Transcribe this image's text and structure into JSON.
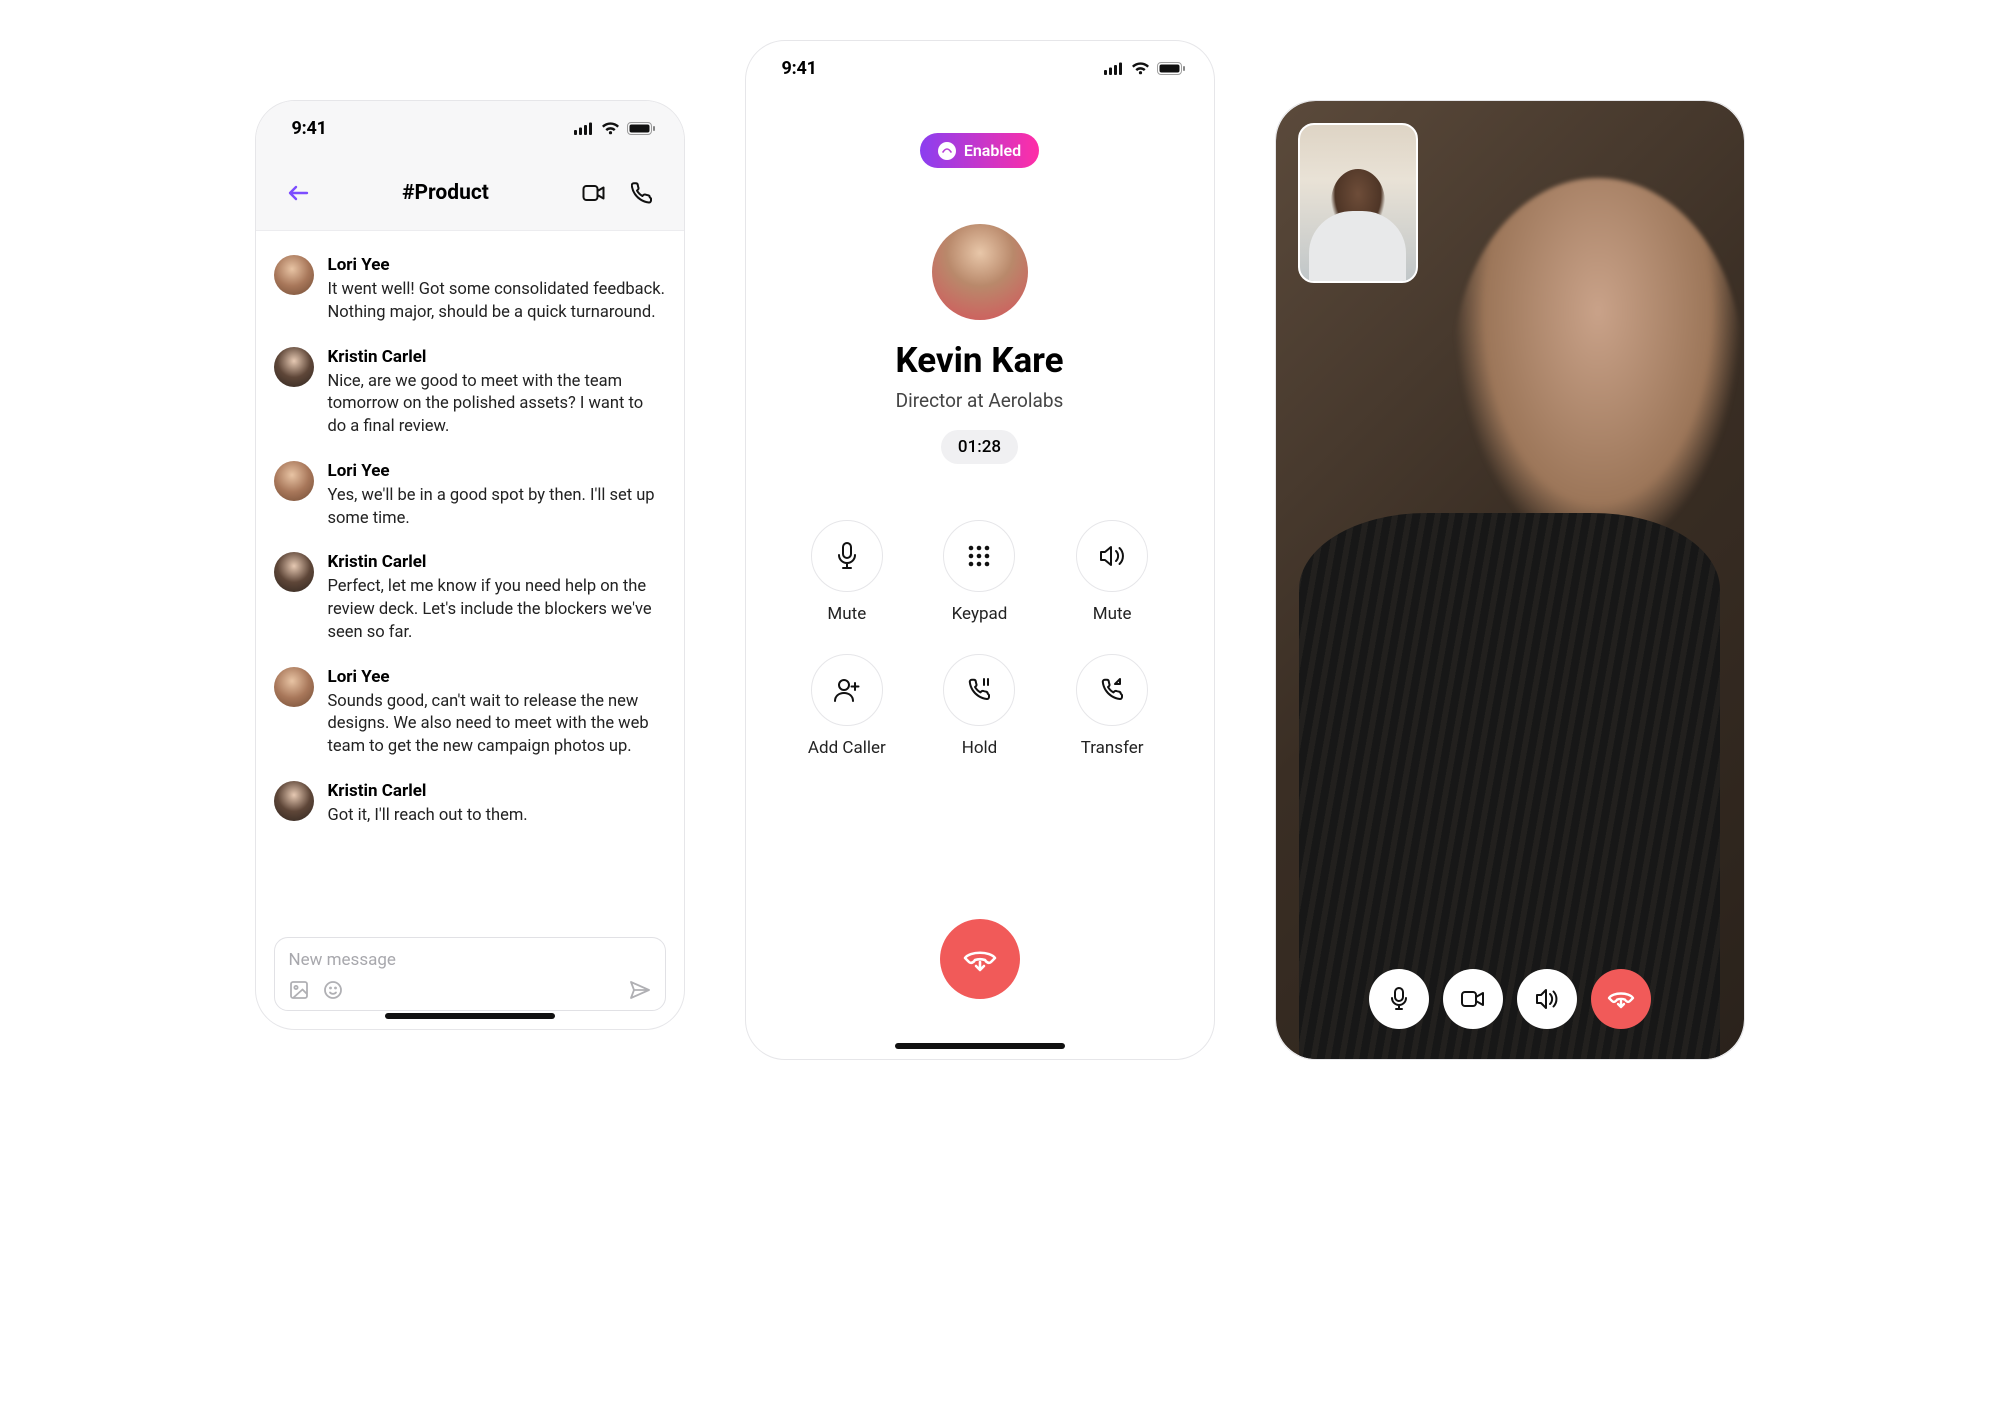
{
  "status": {
    "time": "9:41"
  },
  "chat": {
    "channel": "#Product",
    "composer_placeholder": "New message",
    "messages": [
      {
        "name": "Lori Yee",
        "avatar": "lori",
        "text": "It went well! Got some consolidated feedback. Nothing major, should be a quick turnaround."
      },
      {
        "name": "Kristin Carlel",
        "avatar": "kristin",
        "text": "Nice, are we good to meet with the team tomorrow on the polished assets? I want to do a final review."
      },
      {
        "name": "Lori Yee",
        "avatar": "lori",
        "text": "Yes, we'll be in a good spot by then. I'll set up some time."
      },
      {
        "name": "Kristin Carlel",
        "avatar": "kristin",
        "text": "Perfect, let me know if you need help on the review deck. Let's include the blockers we've seen so far."
      },
      {
        "name": "Lori Yee",
        "avatar": "lori",
        "text": "Sounds good, can't wait to release the new designs. We also need to meet with the web team to get the new campaign photos up."
      },
      {
        "name": "Kristin Carlel",
        "avatar": "kristin",
        "text": "Got it, I'll reach out to them."
      }
    ]
  },
  "call": {
    "pill_label": "Enabled",
    "name": "Kevin Kare",
    "subtitle": "Director at Aerolabs",
    "elapsed": "01:28",
    "buttons": [
      {
        "id": "mute",
        "label": "Mute",
        "icon": "mic"
      },
      {
        "id": "keypad",
        "label": "Keypad",
        "icon": "keypad"
      },
      {
        "id": "speaker",
        "label": "Mute",
        "icon": "speaker"
      },
      {
        "id": "add",
        "label": "Add Caller",
        "icon": "add-user"
      },
      {
        "id": "hold",
        "label": "Hold",
        "icon": "hold"
      },
      {
        "id": "transfer",
        "label": "Transfer",
        "icon": "transfer"
      }
    ]
  },
  "video": {
    "controls": [
      {
        "id": "mic",
        "icon": "mic",
        "style": "white"
      },
      {
        "id": "camera",
        "icon": "camera",
        "style": "white"
      },
      {
        "id": "speaker",
        "icon": "speaker",
        "style": "white"
      },
      {
        "id": "hangup",
        "icon": "hangup",
        "style": "red"
      }
    ]
  }
}
